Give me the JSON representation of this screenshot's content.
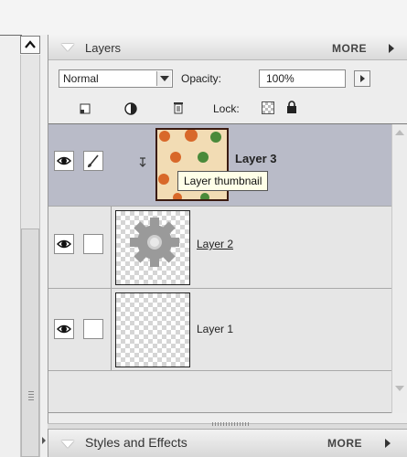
{
  "layers_panel": {
    "title": "Layers",
    "more_label": "MORE",
    "blend_mode": "Normal",
    "opacity_label": "Opacity:",
    "opacity_value": "100%",
    "lock_label": "Lock:"
  },
  "layers": [
    {
      "name": "Layer 3",
      "visible": true,
      "selected": true,
      "thumbnail": "orange-green-dot-pattern"
    },
    {
      "name": "Layer 2",
      "visible": true,
      "selected": false,
      "thumbnail": "gray-gear-on-transparent"
    },
    {
      "name": "Layer 1",
      "visible": true,
      "selected": false,
      "thumbnail": "transparent"
    }
  ],
  "tooltip": "Layer thumbnail",
  "styles_panel": {
    "title": "Styles and Effects",
    "more_label": "MORE"
  },
  "icons": [
    "scroll-up-icon",
    "collapse-icon",
    "more-arrow-icon",
    "dropdown-icon",
    "new-layer-icon",
    "adjustment-layer-icon",
    "trash-icon",
    "lock-transparency-icon",
    "lock-all-icon",
    "eye-icon",
    "brush-icon",
    "clipping-arrow-icon",
    "grip-icon"
  ],
  "colors": {
    "selected_row": "#b9bbc8",
    "thumb_background": "#f2dcb4",
    "dot_orange": "#d8682a",
    "dot_green": "#4a8a3a"
  }
}
